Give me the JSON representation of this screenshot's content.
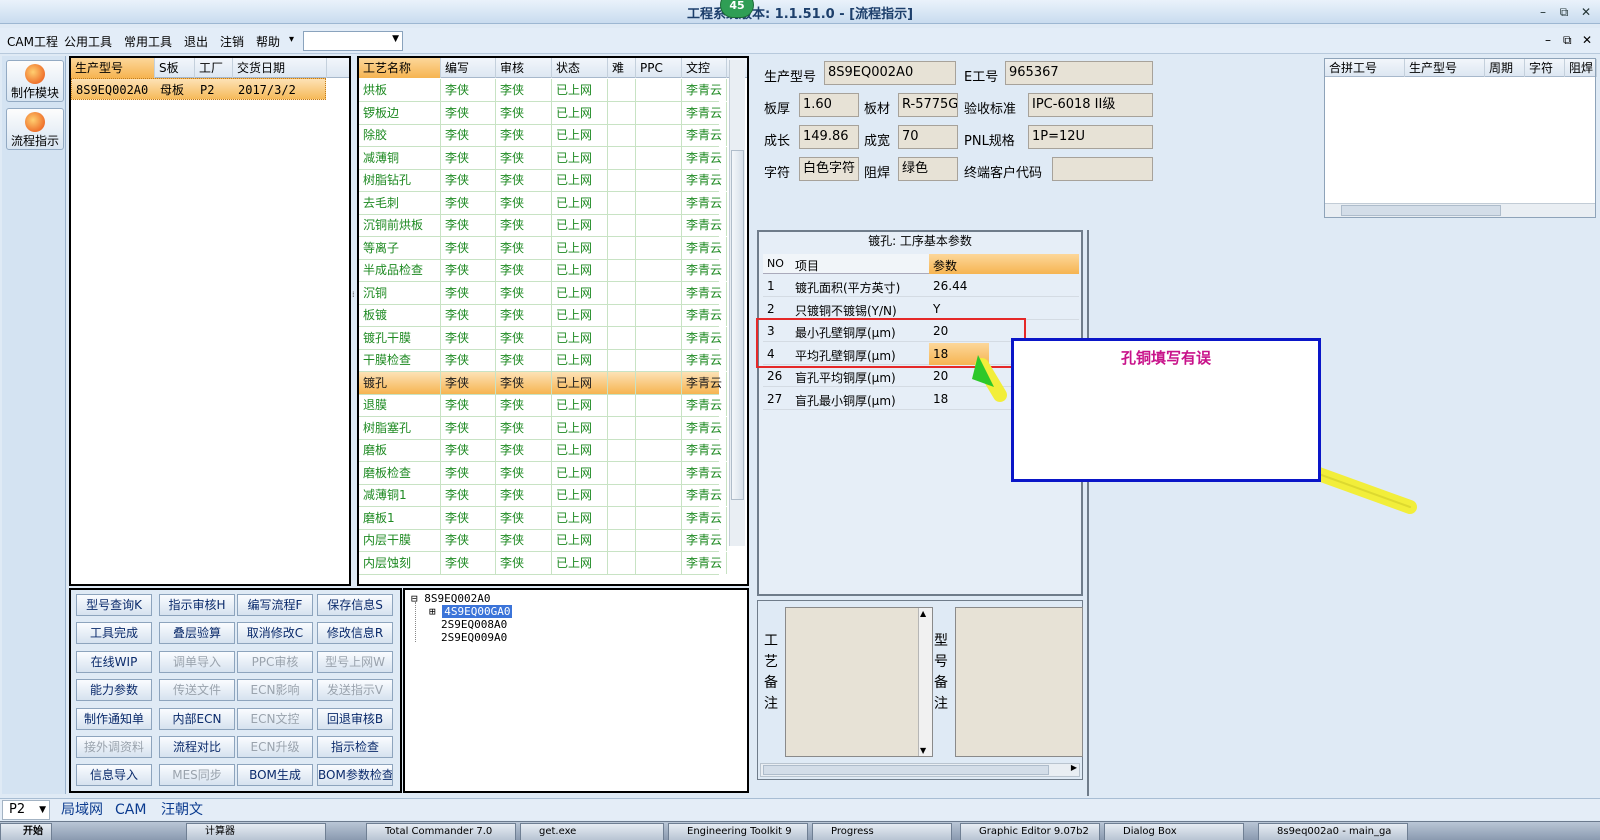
{
  "titlebar": {
    "title": "工程系统版本: 1.1.51.0 - [流程指示]",
    "badge": "45",
    "min": "–",
    "max": "⧉",
    "close": "✕"
  },
  "menu": {
    "items": [
      "CAM工程",
      "公用工具",
      "常用工具",
      "退出",
      "注销",
      "帮助"
    ],
    "help_arrow": "▾",
    "combo_value": "",
    "mdi_min": "–",
    "mdi_max": "⧉",
    "mdi_close": "✕"
  },
  "leftstrip": {
    "btn1": "制作模块",
    "btn2": "流程指示"
  },
  "orders": {
    "headers": [
      "生产型号",
      "S板",
      "工厂",
      "交货日期"
    ],
    "row": [
      "8S9EQ002A0",
      "母板",
      "P2",
      "2017/3/2"
    ]
  },
  "process": {
    "headers": [
      "工艺名称",
      "编写",
      "审核",
      "状态",
      "难",
      "PPC",
      "文控"
    ],
    "rows": [
      [
        "烘板",
        "李侠",
        "李侠",
        "已上网",
        "",
        "",
        "李青云"
      ],
      [
        "锣板边",
        "李侠",
        "李侠",
        "已上网",
        "",
        "",
        "李青云"
      ],
      [
        "除胶",
        "李侠",
        "李侠",
        "已上网",
        "",
        "",
        "李青云"
      ],
      [
        "减薄铜",
        "李侠",
        "李侠",
        "已上网",
        "",
        "",
        "李青云"
      ],
      [
        "树脂钻孔",
        "李侠",
        "李侠",
        "已上网",
        "",
        "",
        "李青云"
      ],
      [
        "去毛刺",
        "李侠",
        "李侠",
        "已上网",
        "",
        "",
        "李青云"
      ],
      [
        "沉铜前烘板",
        "李侠",
        "李侠",
        "已上网",
        "",
        "",
        "李青云"
      ],
      [
        "等离子",
        "李侠",
        "李侠",
        "已上网",
        "",
        "",
        "李青云"
      ],
      [
        "半成品检查",
        "李侠",
        "李侠",
        "已上网",
        "",
        "",
        "李青云"
      ],
      [
        "沉铜",
        "李侠",
        "李侠",
        "已上网",
        "",
        "",
        "李青云"
      ],
      [
        "板镀",
        "李侠",
        "李侠",
        "已上网",
        "",
        "",
        "李青云"
      ],
      [
        "镀孔干膜",
        "李侠",
        "李侠",
        "已上网",
        "",
        "",
        "李青云"
      ],
      [
        "干膜检查",
        "李侠",
        "李侠",
        "已上网",
        "",
        "",
        "李青云"
      ],
      [
        "镀孔",
        "李侠",
        "李侠",
        "已上网",
        "",
        "",
        "李青云"
      ],
      [
        "退膜",
        "李侠",
        "李侠",
        "已上网",
        "",
        "",
        "李青云"
      ],
      [
        "树脂塞孔",
        "李侠",
        "李侠",
        "已上网",
        "",
        "",
        "李青云"
      ],
      [
        "磨板",
        "李侠",
        "李侠",
        "已上网",
        "",
        "",
        "李青云"
      ],
      [
        "磨板检查",
        "李侠",
        "李侠",
        "已上网",
        "",
        "",
        "李青云"
      ],
      [
        "减薄铜1",
        "李侠",
        "李侠",
        "已上网",
        "",
        "",
        "李青云"
      ],
      [
        "磨板1",
        "李侠",
        "李侠",
        "已上网",
        "",
        "",
        "李青云"
      ],
      [
        "内层干膜",
        "李侠",
        "李侠",
        "已上网",
        "",
        "",
        "李青云"
      ],
      [
        "内层蚀刻",
        "李侠",
        "李侠",
        "已上网",
        "",
        "",
        "李青云"
      ]
    ],
    "selected_index": 13
  },
  "buttons": [
    [
      {
        "label": "型号查询K",
        "enabled": true
      },
      {
        "label": "指示审核H",
        "enabled": true
      },
      {
        "label": "编写流程F",
        "enabled": true
      },
      {
        "label": "保存信息S",
        "enabled": true
      }
    ],
    [
      {
        "label": "工具完成",
        "enabled": true
      },
      {
        "label": "叠层验算",
        "enabled": true
      },
      {
        "label": "取消修改C",
        "enabled": true
      },
      {
        "label": "修改信息R",
        "enabled": true
      }
    ],
    [
      {
        "label": "在线WIP",
        "enabled": true
      },
      {
        "label": "调单导入",
        "enabled": false
      },
      {
        "label": "PPC审核",
        "enabled": false
      },
      {
        "label": "型号上网W",
        "enabled": false
      }
    ],
    [
      {
        "label": "能力参数",
        "enabled": true
      },
      {
        "label": "传送文件",
        "enabled": false
      },
      {
        "label": "ECN影响",
        "enabled": false
      },
      {
        "label": "发送指示V",
        "enabled": false
      }
    ],
    [
      {
        "label": "制作通知单",
        "enabled": true
      },
      {
        "label": "内部ECN",
        "enabled": true
      },
      {
        "label": "ECN文控",
        "enabled": false
      },
      {
        "label": "回退审核B",
        "enabled": true
      }
    ],
    [
      {
        "label": "接外调资料",
        "enabled": false
      },
      {
        "label": "流程对比",
        "enabled": true
      },
      {
        "label": "ECN升级",
        "enabled": false
      },
      {
        "label": "指示检查",
        "enabled": true
      }
    ],
    [
      {
        "label": "信息导入",
        "enabled": true
      },
      {
        "label": "MES同步",
        "enabled": false
      },
      {
        "label": "BOM生成",
        "enabled": true
      },
      {
        "label": "BOM参数检查",
        "enabled": true
      }
    ]
  ],
  "tree": {
    "root": "8S9EQ002A0",
    "children": [
      "4S9EQ00GA0",
      "2S9EQ008A0",
      "2S9EQ009A0"
    ],
    "selected_child": 0
  },
  "info": {
    "model_label": "生产型号",
    "model": "8S9EQ002A0",
    "e_label": "E工号",
    "e": "965367",
    "thick_label": "板厚",
    "thick": "1.60",
    "mat_label": "板材",
    "mat": "R-5775G",
    "std_label": "验收标准",
    "std": "IPC-6018 II级",
    "len_label": "成长",
    "len": "149.86",
    "wid_label": "成宽",
    "wid": "70",
    "pnl_label": "PNL规格",
    "pnl": "1P=12U",
    "char_label": "字符",
    "char": "白色字符",
    "mask_label": "阻焊",
    "mask": "绿色",
    "cust_label": "终端客户代码",
    "cust": ""
  },
  "combine": {
    "headers": [
      "合拼工号",
      "生产型号",
      "周期",
      "字符",
      "阻焊"
    ]
  },
  "params": {
    "title": "镀孔: 工序基本参数",
    "headers": [
      "NO",
      "项目",
      "参数"
    ],
    "rows": [
      [
        "1",
        "镀孔面积(平方英寸)",
        "26.44"
      ],
      [
        "2",
        "只镀铜不镀锡(Y/N)",
        "Y"
      ],
      [
        "3",
        "最小孔壁铜厚(μm)",
        "20"
      ],
      [
        "4",
        "平均孔壁铜厚(μm)",
        "18"
      ],
      [
        "26",
        "盲孔平均铜厚(μm)",
        "20"
      ],
      [
        "27",
        "盲孔最小铜厚(μm)",
        "18"
      ]
    ]
  },
  "annotation": {
    "note": "孔铜填写有误",
    "box_color": "#0a16c8",
    "highlight_color": "#e52828",
    "arrow_color": "#f2ee3a"
  },
  "remarks": {
    "process_label": "工艺备注",
    "model_label": "型号备注"
  },
  "status": {
    "factory": "P2",
    "tabs": [
      "局域网",
      "CAM",
      "汪朝文"
    ]
  },
  "taskbar": {
    "start": "开始",
    "items": [
      "计算器",
      "Total Commander 7.0",
      "get.exe",
      "Engineering Toolkit 9",
      "Progress",
      "Graphic Editor 9.07b2",
      "Dialog Box",
      "8s9eq002a0 - main_ga"
    ]
  }
}
